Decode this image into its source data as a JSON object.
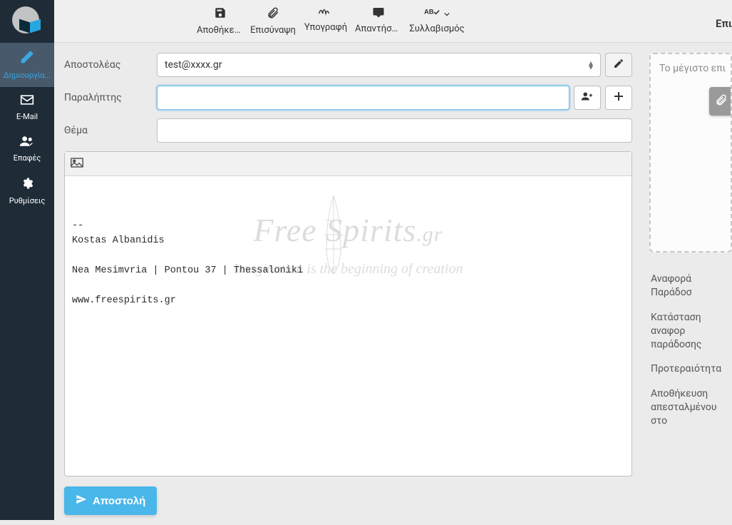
{
  "sidebar": {
    "items": [
      {
        "icon": "compose",
        "label": "Δημιουργία..."
      },
      {
        "icon": "mail",
        "label": "E-Mail"
      },
      {
        "icon": "users",
        "label": "Επαφές"
      },
      {
        "icon": "gear",
        "label": "Ρυθμίσεις"
      }
    ]
  },
  "toolbar": {
    "buttons": [
      {
        "icon": "save",
        "label": "Αποθήκευ..."
      },
      {
        "icon": "attach",
        "label": "Επισύναψη"
      },
      {
        "icon": "sign",
        "label": "Υπογραφή"
      },
      {
        "icon": "reply",
        "label": "Απαντήσεις"
      },
      {
        "icon": "spell",
        "label": "Συλλαβισμός"
      }
    ],
    "right_label": "Επι"
  },
  "fields": {
    "sender": {
      "label": "Αποστολέας",
      "value": "test@xxxx.gr"
    },
    "recipient": {
      "label": "Παραλήπτης",
      "value": ""
    },
    "subject": {
      "label": "Θέμα",
      "value": ""
    }
  },
  "editor": {
    "signature_lines": [
      "--",
      "Kostas Albanidis",
      "",
      "Nea Mesimvria | Pontou 37 | Thessaloniki",
      "",
      "www.freespirits.gr"
    ],
    "watermark_brand": "Free Spirits",
    "watermark_suffix": ".gr",
    "watermark_tag": "Imagination is the beginning of creation"
  },
  "send": {
    "label": "Αποστολή"
  },
  "rightpanel": {
    "dropzone_text": "Το μέγιστο επι",
    "options": [
      "Αναφορά Παράδοσ",
      "Κατάσταση αναφορ παράδοσης",
      "Προτεραιότητα",
      "Αποθήκευση απεσταλμένου στο"
    ]
  }
}
